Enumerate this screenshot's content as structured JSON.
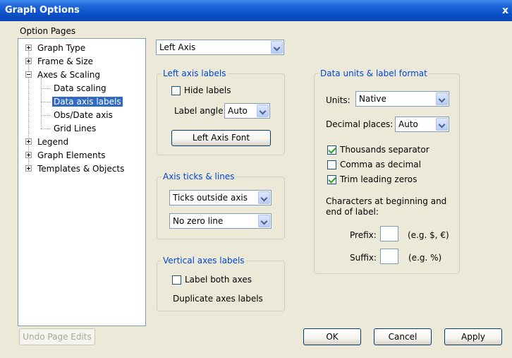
{
  "window": {
    "title": "Graph Options",
    "close_glyph": "x"
  },
  "option_pages": {
    "label": "Option Pages",
    "tree": [
      {
        "label": "Graph Type",
        "expander": "plus"
      },
      {
        "label": "Frame & Size",
        "expander": "plus"
      },
      {
        "label": "Axes & Scaling",
        "expander": "minus"
      },
      {
        "label": "Data scaling"
      },
      {
        "label": "Data axis labels",
        "selected": true
      },
      {
        "label": "Obs/Date axis"
      },
      {
        "label": "Grid Lines"
      },
      {
        "label": "Legend",
        "expander": "plus"
      },
      {
        "label": "Graph Elements",
        "expander": "plus"
      },
      {
        "label": "Templates & Objects",
        "expander": "plus"
      }
    ]
  },
  "axis_select": {
    "value": "Left Axis"
  },
  "left_axis_labels": {
    "legend": "Left axis labels",
    "hide_labels": {
      "label": "Hide labels",
      "checked": false
    },
    "label_angle": {
      "label": "Label angle:",
      "value": "Auto"
    },
    "font_button": "Left Axis Font"
  },
  "axis_ticks": {
    "legend": "Axis ticks & lines",
    "ticks_value": "Ticks outside axis",
    "zero_line_value": "No zero line"
  },
  "vertical_axes": {
    "legend": "Vertical axes labels",
    "label_both": {
      "label": "Label both axes",
      "checked": false
    },
    "duplicate_text": "Duplicate axes labels"
  },
  "data_units": {
    "legend": "Data units & label format",
    "units": {
      "label": "Units:",
      "value": "Native"
    },
    "decimal": {
      "label": "Decimal places:",
      "value": "Auto"
    },
    "thousands": {
      "label": "Thousands separator",
      "checked": true
    },
    "comma": {
      "label": "Comma as decimal",
      "checked": false
    },
    "trim": {
      "label": "Trim leading zeros",
      "checked": true
    },
    "characters_text_1": "Characters at beginning and",
    "characters_text_2": "end of label:",
    "prefix": {
      "label": "Prefix:",
      "hint": "(e.g. $, €)"
    },
    "suffix": {
      "label": "Suffix:",
      "hint": "(e.g. %)"
    }
  },
  "buttons": {
    "undo": "Undo Page Edits",
    "ok": "OK",
    "cancel": "Cancel",
    "apply": "Apply"
  },
  "icons": [
    "close-icon",
    "expand-plus-icon",
    "collapse-minus-icon",
    "dropdown-arrow-icon",
    "checkbox-icon"
  ],
  "colors": {
    "title_bar": "#0a4fc7",
    "selection": "#316ac5",
    "group_legend": "#0046d5",
    "dialog_bg": "#ece9d8"
  }
}
